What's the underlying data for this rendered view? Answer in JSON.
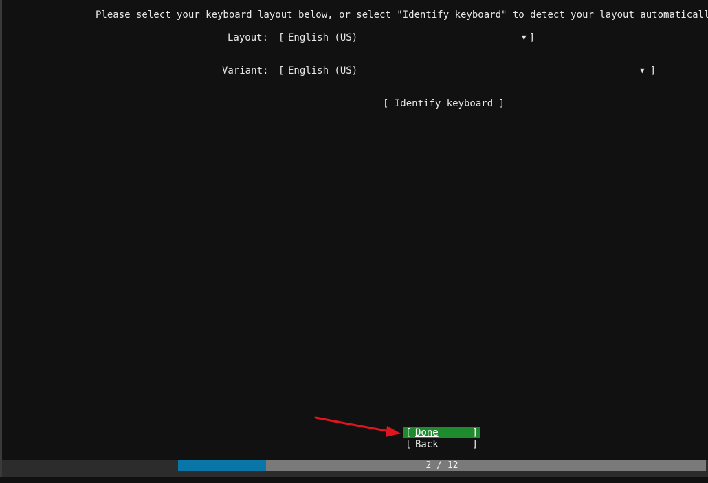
{
  "screen": {
    "intro_text": "Please select your keyboard layout below, or select \"Identify keyboard\" to detect your layout automatically."
  },
  "form": {
    "layout": {
      "label": "Layout:",
      "bracket_open": "[",
      "value": "English (US)",
      "arrow": "▼",
      "bracket_close": "]"
    },
    "variant": {
      "label": "Variant:",
      "bracket_open": "[",
      "value": "English (US)",
      "arrow": "▼",
      "bracket_close": "]"
    },
    "identify_label": "[ Identify keyboard ]"
  },
  "buttons": {
    "done": {
      "open": "[",
      "label": "Done",
      "close": "]"
    },
    "back": {
      "open": "[",
      "label": "Back",
      "close": "]"
    }
  },
  "progress": {
    "current": 2,
    "total": 12,
    "text": "2 / 12",
    "fill_fraction": 0.167
  },
  "colors": {
    "background": "#111111",
    "done_highlight": "#1e8c2e",
    "progress_fill": "#0a76a8",
    "progress_track": "#7a7a7a",
    "annotation_arrow": "#e0141e"
  },
  "icons": {
    "dropdown": "down-triangle-icon",
    "annotation": "red-arrow-icon"
  }
}
